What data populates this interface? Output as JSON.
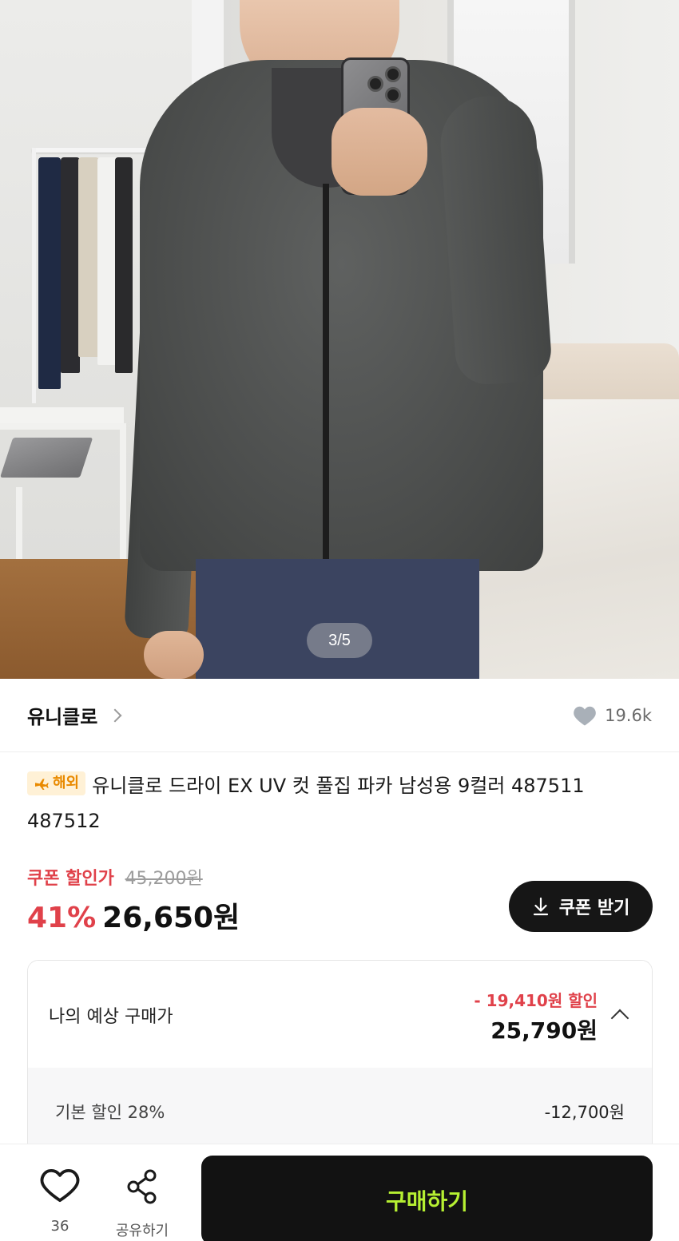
{
  "gallery": {
    "counter": "3/5"
  },
  "seller": {
    "name": "유니클로",
    "likes": "19.6k"
  },
  "product": {
    "badge_label": "해외",
    "title": "유니클로 드라이 EX UV 컷 풀집 파카 남성용 9컬러 487511 487512"
  },
  "price": {
    "coupon_label": "쿠폰 할인가",
    "original": "45,200원",
    "discount_rate": "41%",
    "final": "26,650원",
    "coupon_button": "쿠폰 받기"
  },
  "estimate": {
    "label": "나의 예상 구매가",
    "discount_text": "- 19,410원 할인",
    "price": "25,790원",
    "rows": [
      {
        "label": "기본 할인 28%",
        "amount": "-12,700원"
      }
    ]
  },
  "bottom_bar": {
    "wish_count": "36",
    "share_label": "공유하기",
    "buy_label": "구매하기"
  },
  "colors": {
    "accent_red": "#e0414a",
    "buy_text": "#b6f032",
    "dark": "#121212",
    "badge_text": "#e98a00"
  }
}
